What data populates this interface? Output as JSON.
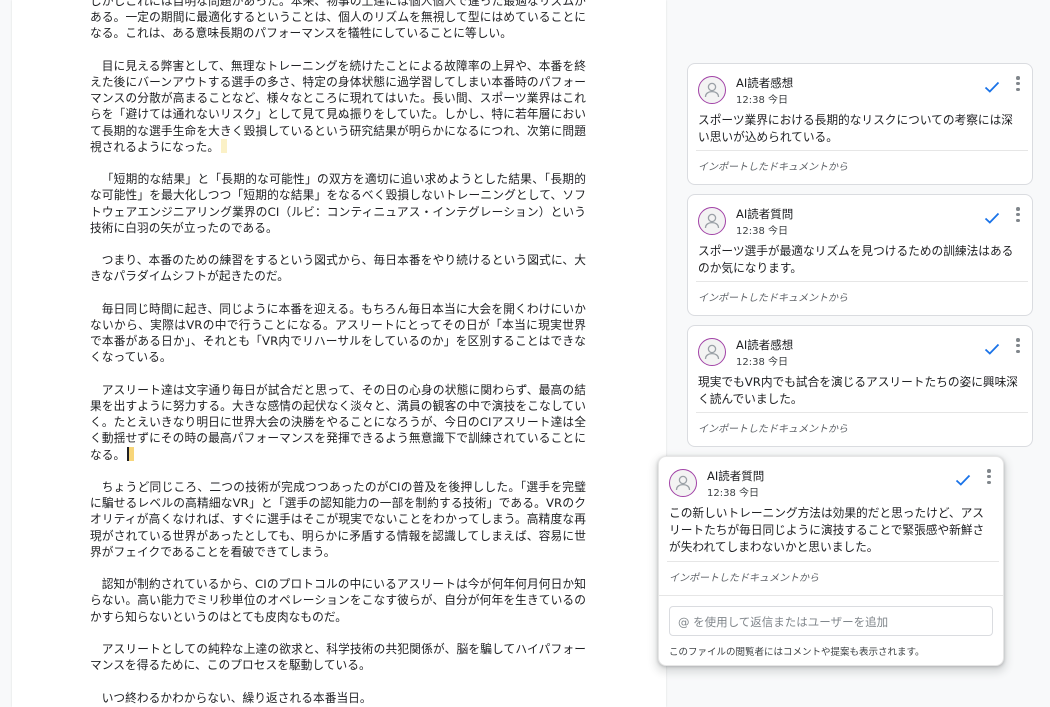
{
  "document": {
    "paragraphs": [
      "しかしこれには自明な問題があった。本来、物事の上達には個人個人で違った最適なリズムがある。一定の期間に最適化するということは、個人のリズムを無視して型にはめていることになる。これは、ある意味長期のパフォーマンスを犠牲にしていることに等しい。",
      "目に見える弊害として、無理なトレーニングを続けたことによる故障率の上昇や、本番を終えた後にバーンアウトする選手の多さ、特定の身体状態に過学習してしまい本番時のパフォーマンスの分散が高まることなど、様々なところに現れてはいた。長い間、スポーツ業界はこれらを「避けては通れないリスク」として見て見ぬ振りをしていた。しかし、特に若年層において長期的な選手生命を大きく毀損しているという研究結果が明らかになるにつれ、次第に問題視されるようになった。",
      "「短期的な結果」と「長期的な可能性」の双方を適切に追い求めようとした結果、「長期的な可能性」を最大化しつつ「短期的な結果」をなるべく毀損しないトレーニングとして、ソフトウェアエンジニアリング業界のCI（ルビ：コンティニュアス・インテグレーション）という技術に白羽の矢が立ったのである。",
      "つまり、本番のための練習をするという図式から、毎日本番をやり続けるという図式に、大きなパラダイムシフトが起きたのだ。",
      "毎日同じ時間に起き、同じように本番を迎える。もちろん毎日本当に大会を開くわけにいかないから、実際はVRの中で行うことになる。アスリートにとってその日が「本当に現実世界で本番がある日か」、それとも「VR内でリハーサルをしているのか」を区別することはできなくなっている。",
      "アスリート達は文字通り毎日が試合だと思って、その日の心身の状態に関わらず、最高の結果を出すように努力する。大きな感情の起伏なく淡々と、満員の観客の中で演技をこなしていく。たとえいきなり明日に世界大会の決勝をやることになろうが、今日のCIアスリート達は全く動揺せずにその時の最高パフォーマンスを発揮できるよう無意識下で訓練されていることになる。",
      "ちょうど同じころ、二つの技術が完成つつあったのがCIの普及を後押しした。「選手を完璧に騙せるレベルの高精細なVR」と「選手の認知能力の一部を制約する技術」である。VRのクオリティが高くなければ、すぐに選手はそこが現実でないことをわかってしまう。高精度な再現がされている世界があったとしても、明らかに矛盾する情報を認識してしまえば、容易に世界がフェイクであることを看破できてしまう。",
      "認知が制約されているから、CIのプロトコルの中にいるアスリートは今が何年何月何日か知らない。高い能力でミリ秒単位のオペレーションをこなす彼らが、自分が何年を生きているのかすら知らないというのはとても皮肉なものだ。",
      "アスリートとしての純粋な上達の欲求と、科学技術の共犯関係が、脳を騙してハイパフォーマンスを得るために、このプロセスを駆動している。",
      "いつ終わるかわからない、繰り返される本番当日。"
    ]
  },
  "comments": [
    {
      "author": "AI読者感想",
      "time": "12:38 今日",
      "body": "スポーツ業界における長期的なリスクについての考察には深い思いが込められている。",
      "source": "インポートしたドキュメントから"
    },
    {
      "author": "AI読者質問",
      "time": "12:38 今日",
      "body": "スポーツ選手が最適なリズムを見つけるための訓練法はあるのか気になります。",
      "source": "インポートしたドキュメントから"
    },
    {
      "author": "AI読者感想",
      "time": "12:38 今日",
      "body": "現実でもVR内でも試合を演じるアスリートたちの姿に興味深く読んでいました。",
      "source": "インポートしたドキュメントから"
    },
    {
      "author": "AI読者質問",
      "time": "12:38 今日",
      "body": "この新しいトレーニング方法は効果的だと思ったけど、アスリートたちが毎日同じように演技することで緊張感や新鮮さが失われてしまわないかと思いました。",
      "source": "インポートしたドキュメントから"
    }
  ],
  "reply": {
    "placeholder": "@ を使用して返信またはユーザーを追加",
    "note": "このファイルの閲覧者にはコメントや提案も表示されます。"
  },
  "icons": {
    "avatar": "person-icon",
    "resolve": "check-icon",
    "more": "more-vert-icon"
  },
  "colors": {
    "accent": "#1a73e8",
    "avatar_border": "#a142a6"
  }
}
